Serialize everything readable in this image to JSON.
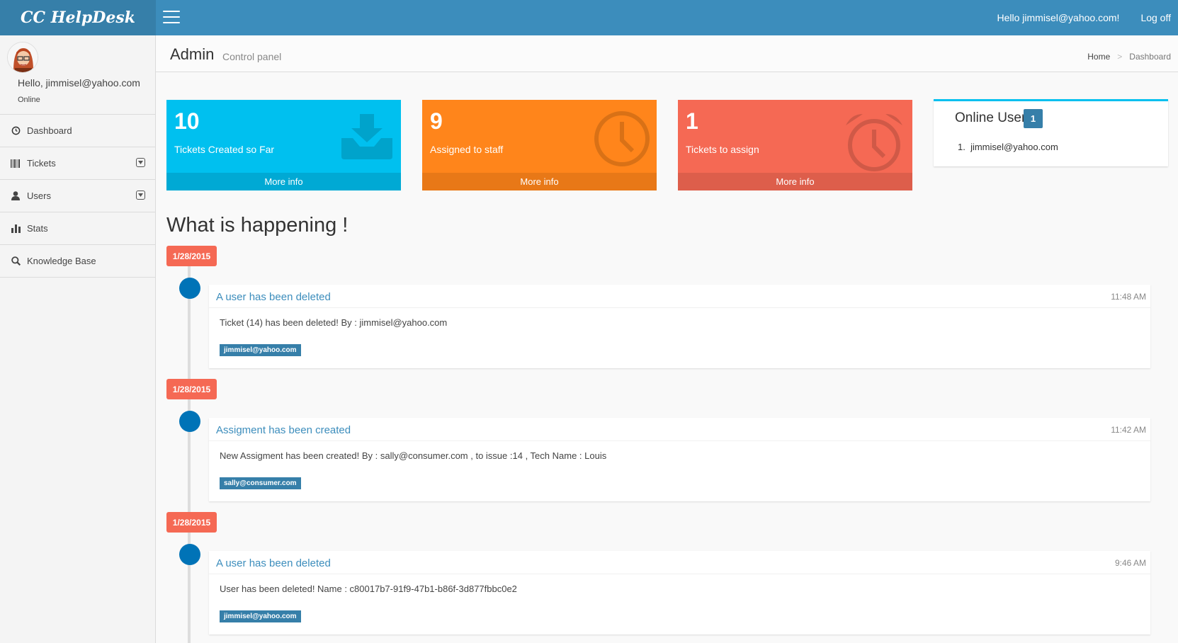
{
  "header": {
    "logo": "CC HelpDesk",
    "greeting": "Hello jimmisel@yahoo.com!",
    "logoff": "Log off",
    "color": "#3c8dbc"
  },
  "sidebar": {
    "user_greeting": "Hello, jimmisel@yahoo.com",
    "status": "Online",
    "items": [
      {
        "label": "Dashboard",
        "icon": "clock-icon"
      },
      {
        "label": "Tickets",
        "icon": "barcode-icon"
      },
      {
        "label": "Users",
        "icon": "user-icon"
      },
      {
        "label": "Stats",
        "icon": "bar-chart-icon"
      },
      {
        "label": "Knowledge Base",
        "icon": "search-icon"
      }
    ]
  },
  "content_header": {
    "title": "Admin",
    "subtitle": "Control panel",
    "breadcrumb": {
      "home": "Home",
      "separator": ">",
      "current": "Dashboard"
    }
  },
  "boxes": [
    {
      "number": "10",
      "label": "Tickets Created so Far",
      "footer": "More info",
      "color": "#00c0ef",
      "icon": "download-tray-icon"
    },
    {
      "number": "9",
      "label": "Assigned to staff",
      "footer": "More info",
      "color": "#ff851b",
      "icon": "clock-icon"
    },
    {
      "number": "1",
      "label": "Tickets to assign",
      "footer": "More info",
      "color": "#f56954",
      "icon": "alarm-clock-icon"
    }
  ],
  "online": {
    "title": "Online User",
    "count": "1",
    "users": [
      "jimmisel@yahoo.com"
    ]
  },
  "timeline": {
    "title": "What is happening !",
    "items": [
      {
        "date": "1/28/2015",
        "title": "A user has been deleted",
        "time": "11:48 AM",
        "body": "Ticket (14) has been deleted! By : jimmisel@yahoo.com",
        "tag": "jimmisel@yahoo.com"
      },
      {
        "date": "1/28/2015",
        "title": "Assigment has been created",
        "time": "11:42 AM",
        "body": "New Assigment has been created! By : sally@consumer.com , to issue :14 , Tech Name : Louis",
        "tag": "sally@consumer.com"
      },
      {
        "date": "1/28/2015",
        "title": "A user has been deleted",
        "time": "9:46 AM",
        "body": "User has been deleted! Name : c80017b7-91f9-47b1-b86f-3d877fbbc0e2",
        "tag": "jimmisel@yahoo.com"
      }
    ]
  }
}
